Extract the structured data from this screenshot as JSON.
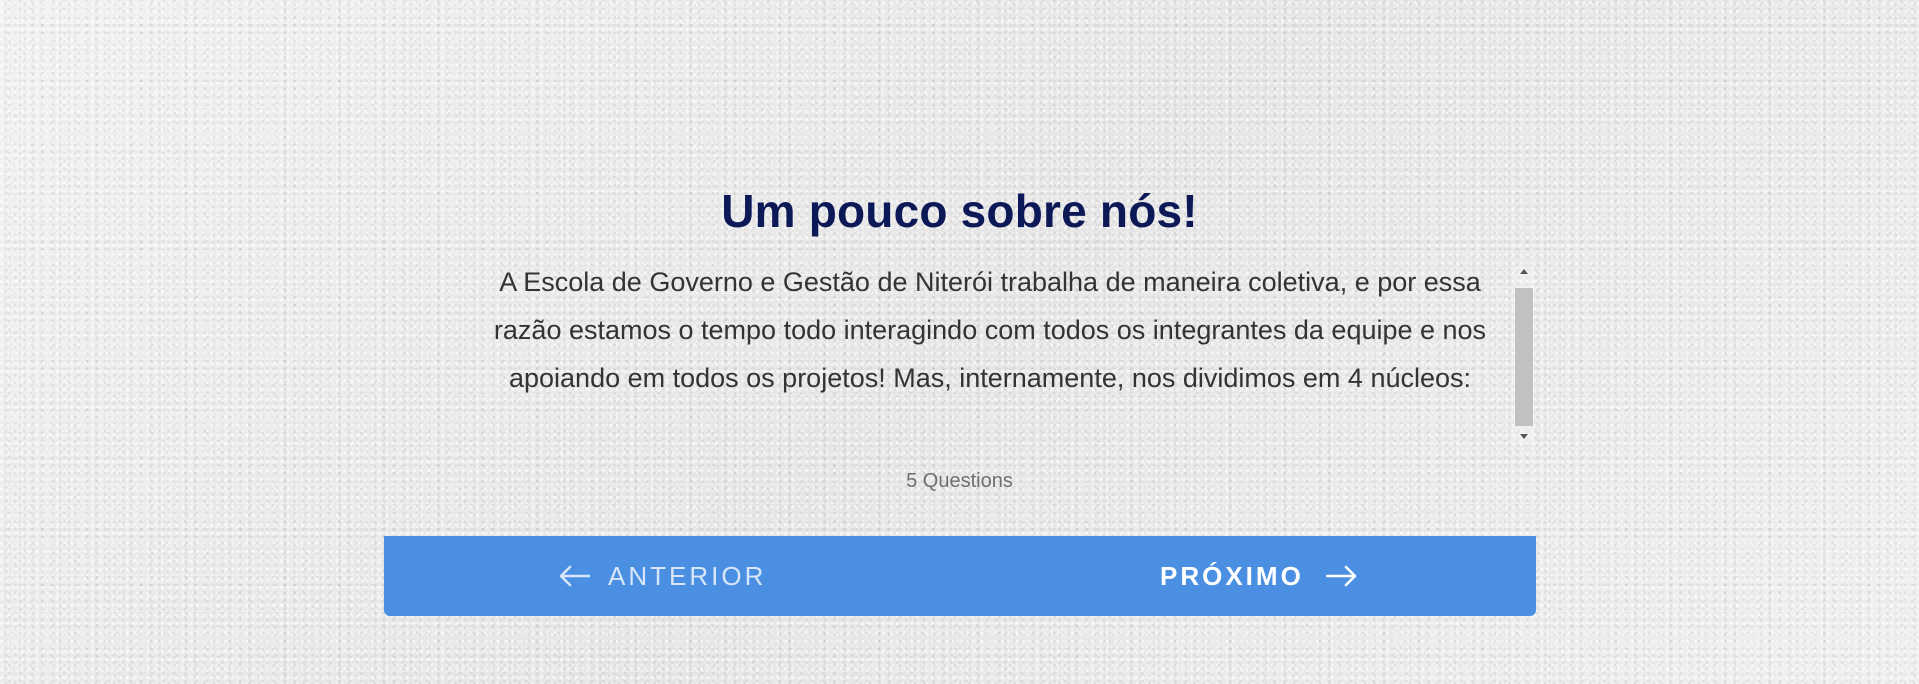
{
  "card": {
    "title": "Um pouco sobre nós!",
    "description": "A Escola de Governo e Gestão de Niterói trabalha de maneira coletiva, e por essa razão estamos  o tempo todo interagindo com todos os integrantes da equipe e nos apoiando em todos os projetos!  Mas, internamente, nos dividimos em 4 núcleos:",
    "question_count": "5 Questions"
  },
  "navigation": {
    "previous_label": "ANTERIOR",
    "previous_icon": "arrow-left-icon",
    "next_label": "PRÓXIMO",
    "next_icon": "arrow-right-icon"
  },
  "colors": {
    "title": "#0d1857",
    "nav_bar": "#4a8fe2",
    "nav_text": "#ffffff"
  }
}
